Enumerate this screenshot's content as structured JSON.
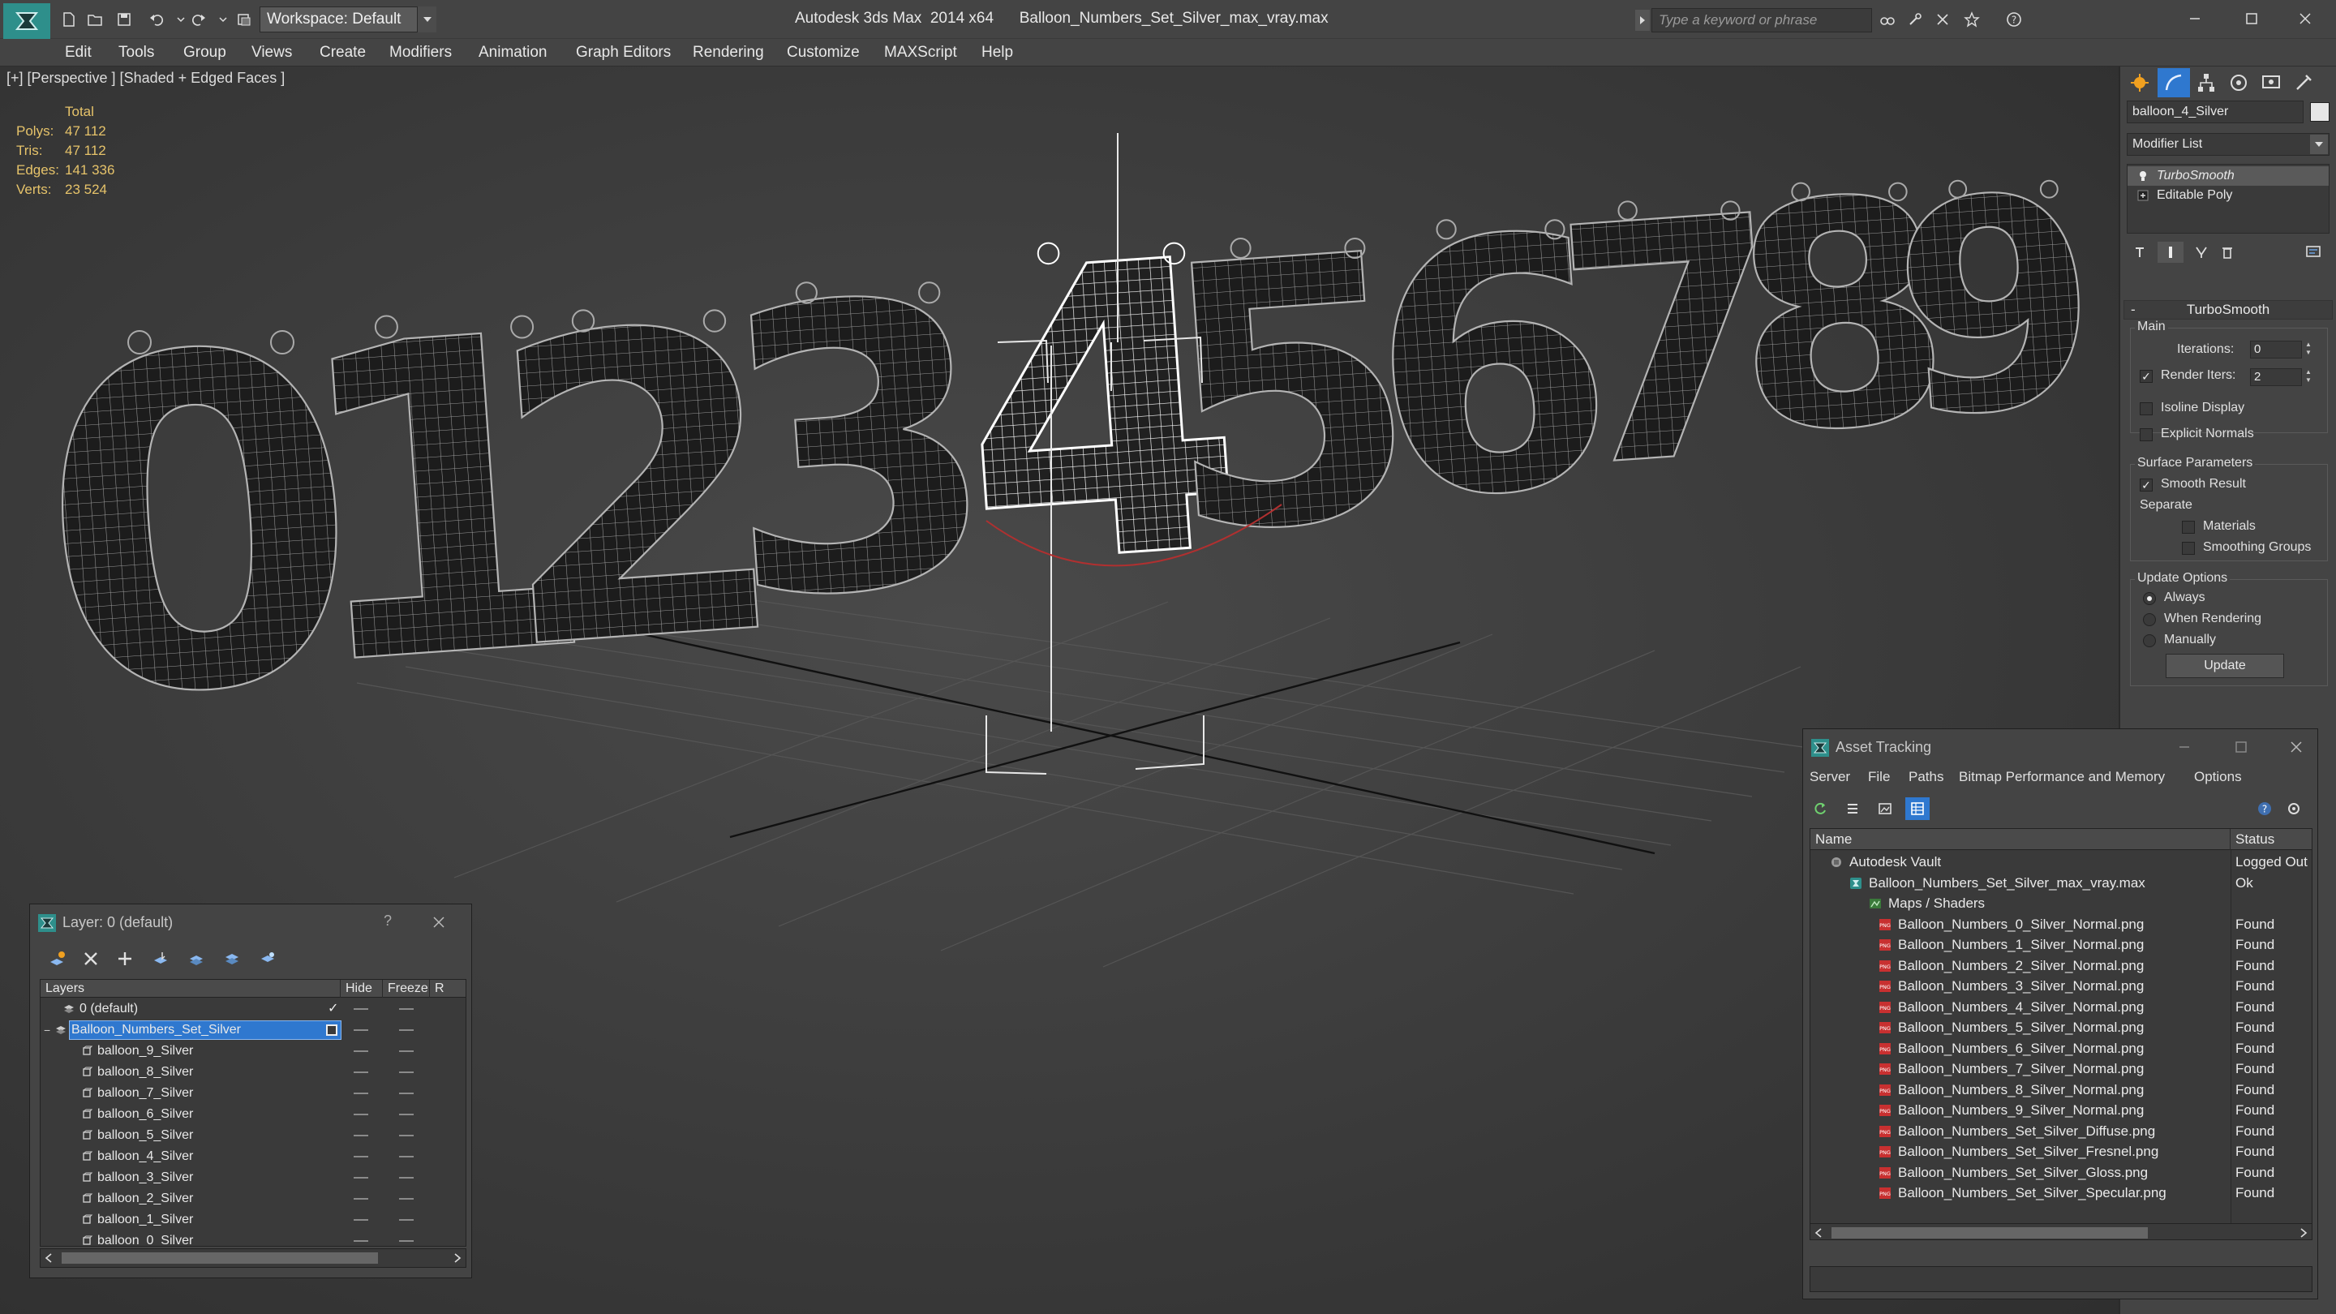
{
  "titlebar": {
    "workspace": "Workspace: Default",
    "app_title": "Autodesk 3ds Max  2014 x64",
    "file_title": "Balloon_Numbers_Set_Silver_max_vray.max",
    "search_placeholder": "Type a keyword or phrase"
  },
  "menu": [
    "Edit",
    "Tools",
    "Group",
    "Views",
    "Create",
    "Modifiers",
    "Animation",
    "Graph Editors",
    "Rendering",
    "Customize",
    "MAXScript",
    "Help"
  ],
  "viewport": {
    "label": "[+] [Perspective ] [Shaded + Edged Faces ]",
    "stats_header": "Total",
    "stats": [
      {
        "label": "Polys:",
        "value": "47 112"
      },
      {
        "label": "Tris:",
        "value": "47 112"
      },
      {
        "label": "Edges:",
        "value": "141 336"
      },
      {
        "label": "Verts:",
        "value": "23 524"
      }
    ],
    "digits": [
      "0",
      "1",
      "2",
      "3",
      "4",
      "5",
      "6",
      "7",
      "8",
      "9"
    ],
    "selected_digit": "4"
  },
  "command_panel": {
    "object_name": "balloon_4_Silver",
    "modifier_list": "Modifier List",
    "stack": [
      "TurboSmooth",
      "Editable Poly"
    ],
    "turbosmooth_title": "TurboSmooth",
    "main_group": "Main",
    "iterations_label": "Iterations:",
    "iterations_value": "0",
    "render_iters_label": "Render Iters:",
    "render_iters_value": "2",
    "render_iters_checked": true,
    "isoline_label": "Isoline Display",
    "explicit_label": "Explicit Normals",
    "surface_group": "Surface Parameters",
    "smooth_result_label": "Smooth Result",
    "separate_label": "Separate",
    "materials_label": "Materials",
    "smoothing_groups_label": "Smoothing Groups",
    "update_group": "Update Options",
    "update_options": [
      "Always",
      "When Rendering",
      "Manually"
    ],
    "update_selected": "Always",
    "update_button": "Update"
  },
  "layer_window": {
    "title": "Layer: 0 (default)",
    "help": "?",
    "columns": [
      "Layers",
      "Hide",
      "Freeze",
      "R"
    ],
    "rows": [
      {
        "name": "0 (default)",
        "level": 1
      },
      {
        "name": "Balloon_Numbers_Set_Silver",
        "level": 0
      },
      {
        "name": "balloon_9_Silver",
        "level": 2
      },
      {
        "name": "balloon_8_Silver",
        "level": 2
      },
      {
        "name": "balloon_7_Silver",
        "level": 2
      },
      {
        "name": "balloon_6_Silver",
        "level": 2
      },
      {
        "name": "balloon_5_Silver",
        "level": 2
      },
      {
        "name": "balloon_4_Silver",
        "level": 2
      },
      {
        "name": "balloon_3_Silver",
        "level": 2
      },
      {
        "name": "balloon_2_Silver",
        "level": 2
      },
      {
        "name": "balloon_1_Silver",
        "level": 2
      },
      {
        "name": "balloon_0_Silver",
        "level": 2
      }
    ],
    "selected_row": "Balloon_Numbers_Set_Silver"
  },
  "asset_window": {
    "title": "Asset Tracking",
    "menu": [
      "Server",
      "File",
      "Paths",
      "Bitmap Performance and Memory",
      "Options"
    ],
    "columns": [
      "Name",
      "Status"
    ],
    "rows": [
      {
        "name": "Autodesk Vault",
        "status": "Logged Out",
        "level": 0,
        "icon": "vault"
      },
      {
        "name": "Balloon_Numbers_Set_Silver_max_vray.max",
        "status": "Ok",
        "level": 1,
        "icon": "max"
      },
      {
        "name": "Maps / Shaders",
        "status": "",
        "level": 2,
        "icon": "maps"
      },
      {
        "name": "Balloon_Numbers_0_Silver_Normal.png",
        "status": "Found",
        "level": 3,
        "icon": "png"
      },
      {
        "name": "Balloon_Numbers_1_Silver_Normal.png",
        "status": "Found",
        "level": 3,
        "icon": "png"
      },
      {
        "name": "Balloon_Numbers_2_Silver_Normal.png",
        "status": "Found",
        "level": 3,
        "icon": "png"
      },
      {
        "name": "Balloon_Numbers_3_Silver_Normal.png",
        "status": "Found",
        "level": 3,
        "icon": "png"
      },
      {
        "name": "Balloon_Numbers_4_Silver_Normal.png",
        "status": "Found",
        "level": 3,
        "icon": "png"
      },
      {
        "name": "Balloon_Numbers_5_Silver_Normal.png",
        "status": "Found",
        "level": 3,
        "icon": "png"
      },
      {
        "name": "Balloon_Numbers_6_Silver_Normal.png",
        "status": "Found",
        "level": 3,
        "icon": "png"
      },
      {
        "name": "Balloon_Numbers_7_Silver_Normal.png",
        "status": "Found",
        "level": 3,
        "icon": "png"
      },
      {
        "name": "Balloon_Numbers_8_Silver_Normal.png",
        "status": "Found",
        "level": 3,
        "icon": "png"
      },
      {
        "name": "Balloon_Numbers_9_Silver_Normal.png",
        "status": "Found",
        "level": 3,
        "icon": "png"
      },
      {
        "name": "Balloon_Numbers_Set_Silver_Diffuse.png",
        "status": "Found",
        "level": 3,
        "icon": "png"
      },
      {
        "name": "Balloon_Numbers_Set_Silver_Fresnel.png",
        "status": "Found",
        "level": 3,
        "icon": "png"
      },
      {
        "name": "Balloon_Numbers_Set_Silver_Gloss.png",
        "status": "Found",
        "level": 3,
        "icon": "png"
      },
      {
        "name": "Balloon_Numbers_Set_Silver_Specular.png",
        "status": "Found",
        "level": 3,
        "icon": "png"
      }
    ]
  },
  "colors": {
    "ui_bg": "#444444",
    "viewport_bg": "#3b3b3b",
    "selection": "#2f78cf",
    "stats_text": "#e6c36a",
    "logo": "#2e8f8b"
  }
}
